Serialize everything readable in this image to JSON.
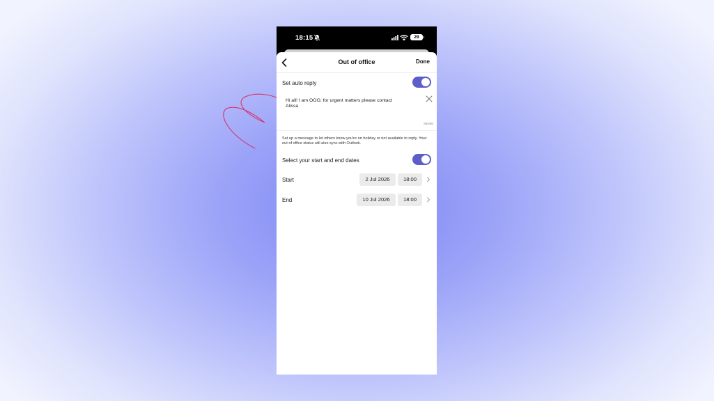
{
  "status_bar": {
    "time": "18:15",
    "battery": "29"
  },
  "nav": {
    "title": "Out of office",
    "done_label": "Done"
  },
  "auto_reply": {
    "label": "Set auto reply",
    "enabled": true
  },
  "message": {
    "text": "Hi all! I am OOO, for urgent matters please contact Alissa",
    "char_count": "58/280"
  },
  "help_text": "Set up a message to let others know you're on holiday or not available to reply. Your out of office status will also sync with Outlook.",
  "dates": {
    "label": "Select your start and end dates",
    "enabled": true,
    "start": {
      "label": "Start",
      "date": "2 Jul 2026",
      "time": "18:00"
    },
    "end": {
      "label": "End",
      "date": "10 Jul 2026",
      "time": "18:00"
    }
  },
  "colors": {
    "accent": "#5b5fc7",
    "annotation": "#d6336c"
  },
  "icons": [
    "bell-slash-icon",
    "wifi-icon",
    "battery-icon",
    "back-chevron-icon",
    "close-icon",
    "chevron-right-icon"
  ]
}
